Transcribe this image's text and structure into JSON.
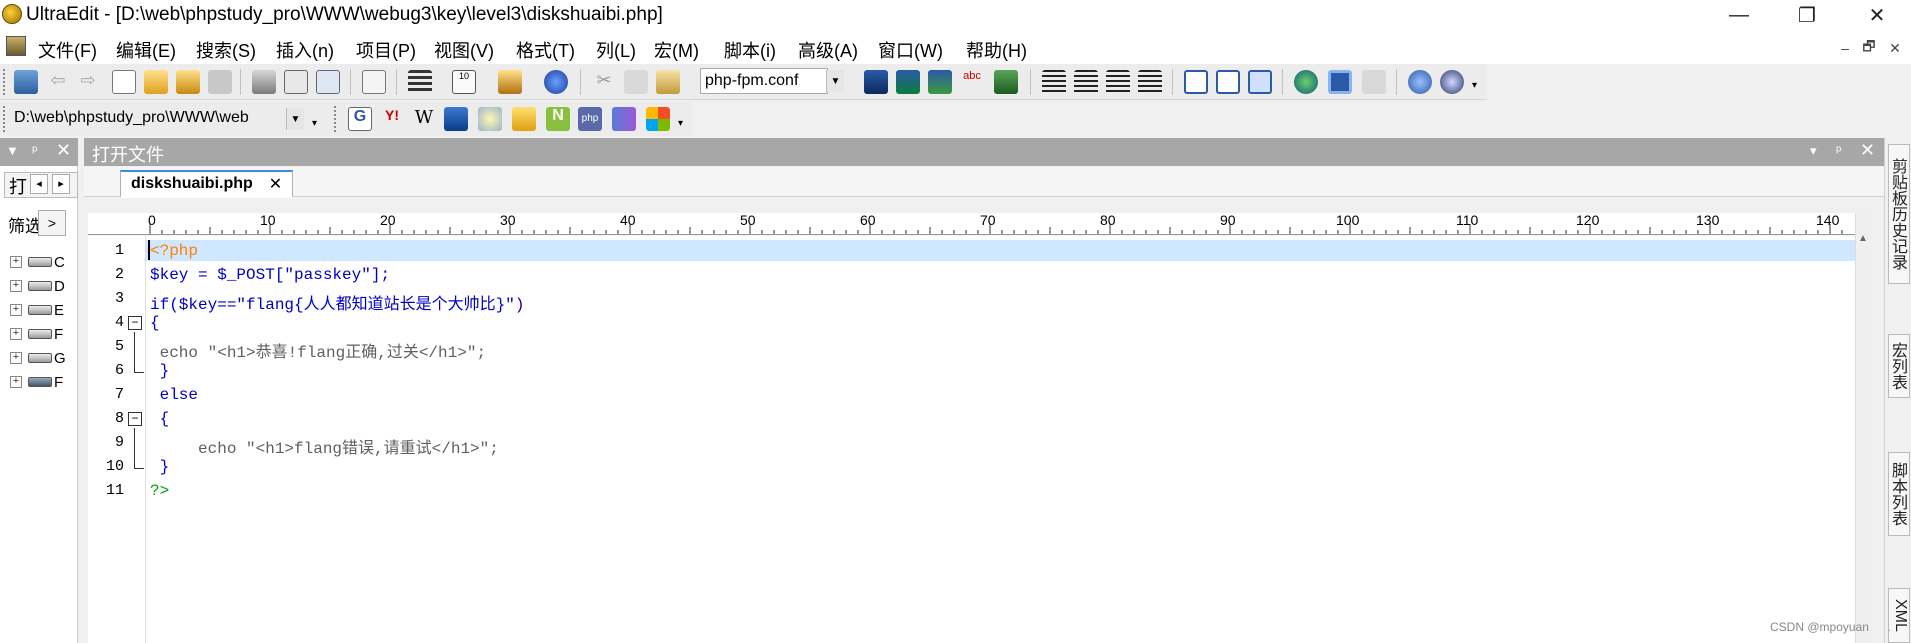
{
  "window": {
    "title": "UltraEdit - [D:\\web\\phpstudy_pro\\WWW\\webug3\\key\\level3\\diskshuaibi.php]",
    "controls": [
      "—",
      "❐",
      "✕"
    ]
  },
  "menu": {
    "items": [
      "文件(F)",
      "编辑(E)",
      "搜索(S)",
      "插入(n)",
      "项目(P)",
      "视图(V)",
      "格式(T)",
      "列(L)",
      "宏(M)",
      "脚本(i)",
      "高级(A)",
      "窗口(W)",
      "帮助(H)"
    ],
    "mdi_controls": [
      "–",
      "🗗",
      "✕"
    ]
  },
  "toolbar1": {
    "dropdown_value": "php-fpm.conf"
  },
  "toolbar2": {
    "path_value": "D:\\web\\phpstudy_pro\\WWW\\web"
  },
  "left_panel": {
    "tab_label": "打",
    "filter_label": "筛选",
    "filter_btn": ">",
    "tree_items": [
      "C",
      "D",
      "E",
      "F",
      "G",
      "F"
    ]
  },
  "file_panel": {
    "header_title": "打开文件",
    "header_controls": [
      "▾",
      "ᵖ",
      "✕"
    ],
    "tab_name": "diskshuaibi.php",
    "tab_close": "✕"
  },
  "ruler": {
    "labels": [
      "0",
      "10",
      "20",
      "30",
      "40",
      "50",
      "60",
      "70",
      "80",
      "90",
      "100",
      "110",
      "120",
      "130",
      "140"
    ]
  },
  "code_lines": [
    {
      "n": "1",
      "text": "<?php"
    },
    {
      "n": "2",
      "text": "$key = $_POST[\"passkey\"];"
    },
    {
      "n": "3",
      "text": "if($key==\"flang{人人都知道站长是个大帅比}\")"
    },
    {
      "n": "4",
      "text": "{"
    },
    {
      "n": "5",
      "text": " echo \"<h1>恭喜!flang正确,过关</h1>\";"
    },
    {
      "n": "6",
      "text": " }"
    },
    {
      "n": "7",
      "text": " else"
    },
    {
      "n": "8",
      "text": " {"
    },
    {
      "n": "9",
      "text": "     echo \"<h1>flang错误,请重试</h1>\";"
    },
    {
      "n": "10",
      "text": " }"
    },
    {
      "n": "11",
      "text": "?>"
    }
  ],
  "right_panel": {
    "tabs": [
      "剪贴板历史记录",
      "宏列表",
      "脚本列表",
      "XML 管理器"
    ]
  },
  "watermark": "CSDN @mpoyuan",
  "colors": {
    "keyword": "#0000ff",
    "variable": "#ff8000",
    "string": "#808080",
    "php_tag": "#ff0000",
    "caret_line": "#cfe8ff"
  }
}
